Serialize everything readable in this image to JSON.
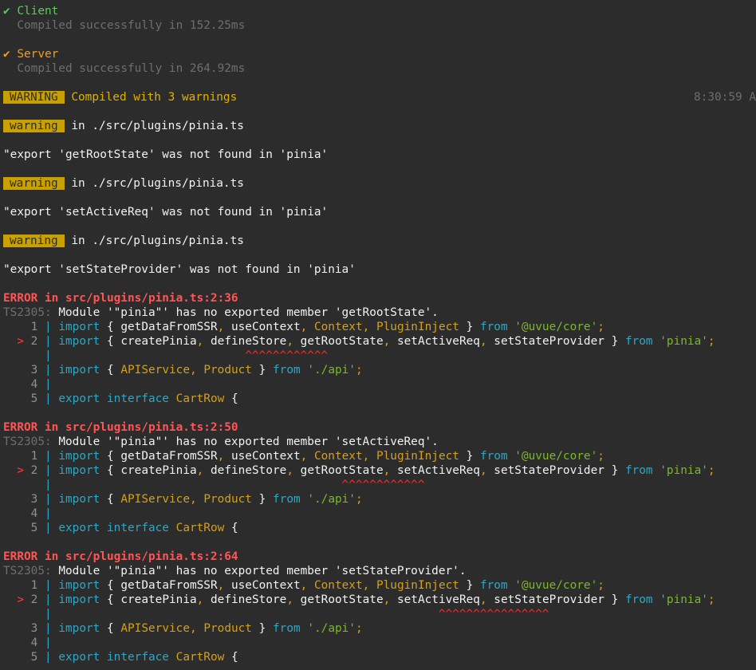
{
  "client": {
    "check": "✔",
    "label": "Client",
    "status": "Compiled successfully in 152.25ms"
  },
  "server": {
    "check": "✔",
    "label": "Server",
    "status": "Compiled successfully in 264.92ms"
  },
  "summary": {
    "badge": "WARNING",
    "text": "Compiled with 3 warnings",
    "time": "8:30:59 A"
  },
  "warnings": [
    {
      "badge": "warning",
      "location": "in ./src/plugins/pinia.ts",
      "message": "\"export 'getRootState' was not found in 'pinia'"
    },
    {
      "badge": "warning",
      "location": "in ./src/plugins/pinia.ts",
      "message": "\"export 'setActiveReq' was not found in 'pinia'"
    },
    {
      "badge": "warning",
      "location": "in ./src/plugins/pinia.ts",
      "message": "\"export 'setStateProvider' was not found in 'pinia'"
    }
  ],
  "code_lines": {
    "n1": "1",
    "n2": "2",
    "n3": "3",
    "n4": "4",
    "n5": "5",
    "pipe": "|",
    "arrow": ">",
    "kw_import": "import",
    "kw_from": "from",
    "kw_export": "export",
    "kw_interface": "interface",
    "lbrace": "{",
    "rbrace": "}",
    "comma": ",",
    "semi": ";",
    "getDataFromSSR": "getDataFromSSR",
    "useContext": "useContext",
    "Context": "Context",
    "PluginInject": "PluginInject",
    "core_str": "'@uvue/core'",
    "createPinia": "createPinia",
    "defineStore": "defineStore",
    "getRootState": "getRootState",
    "setActiveReq": "setActiveReq",
    "setStateProvider": "setStateProvider",
    "pinia_str": "'pinia'",
    "APIService": "APIService",
    "Product": "Product",
    "api_str": "'./api'",
    "CartRow": "CartRow"
  },
  "errors": [
    {
      "title": "ERROR in src/plugins/pinia.ts:2:36",
      "code": "TS2305",
      "colon": ":",
      "message": "Module '\"pinia\"' has no exported member 'getRootState'.",
      "carets": "^^^^^^^^^^^^"
    },
    {
      "title": "ERROR in src/plugins/pinia.ts:2:50",
      "code": "TS2305",
      "colon": ":",
      "message": "Module '\"pinia\"' has no exported member 'setActiveReq'.",
      "carets": "^^^^^^^^^^^^"
    },
    {
      "title": "ERROR in src/plugins/pinia.ts:2:64",
      "code": "TS2305",
      "colon": ":",
      "message": "Module '\"pinia\"' has no exported member 'setStateProvider'.",
      "carets": "^^^^^^^^^^^^^^^^"
    }
  ]
}
